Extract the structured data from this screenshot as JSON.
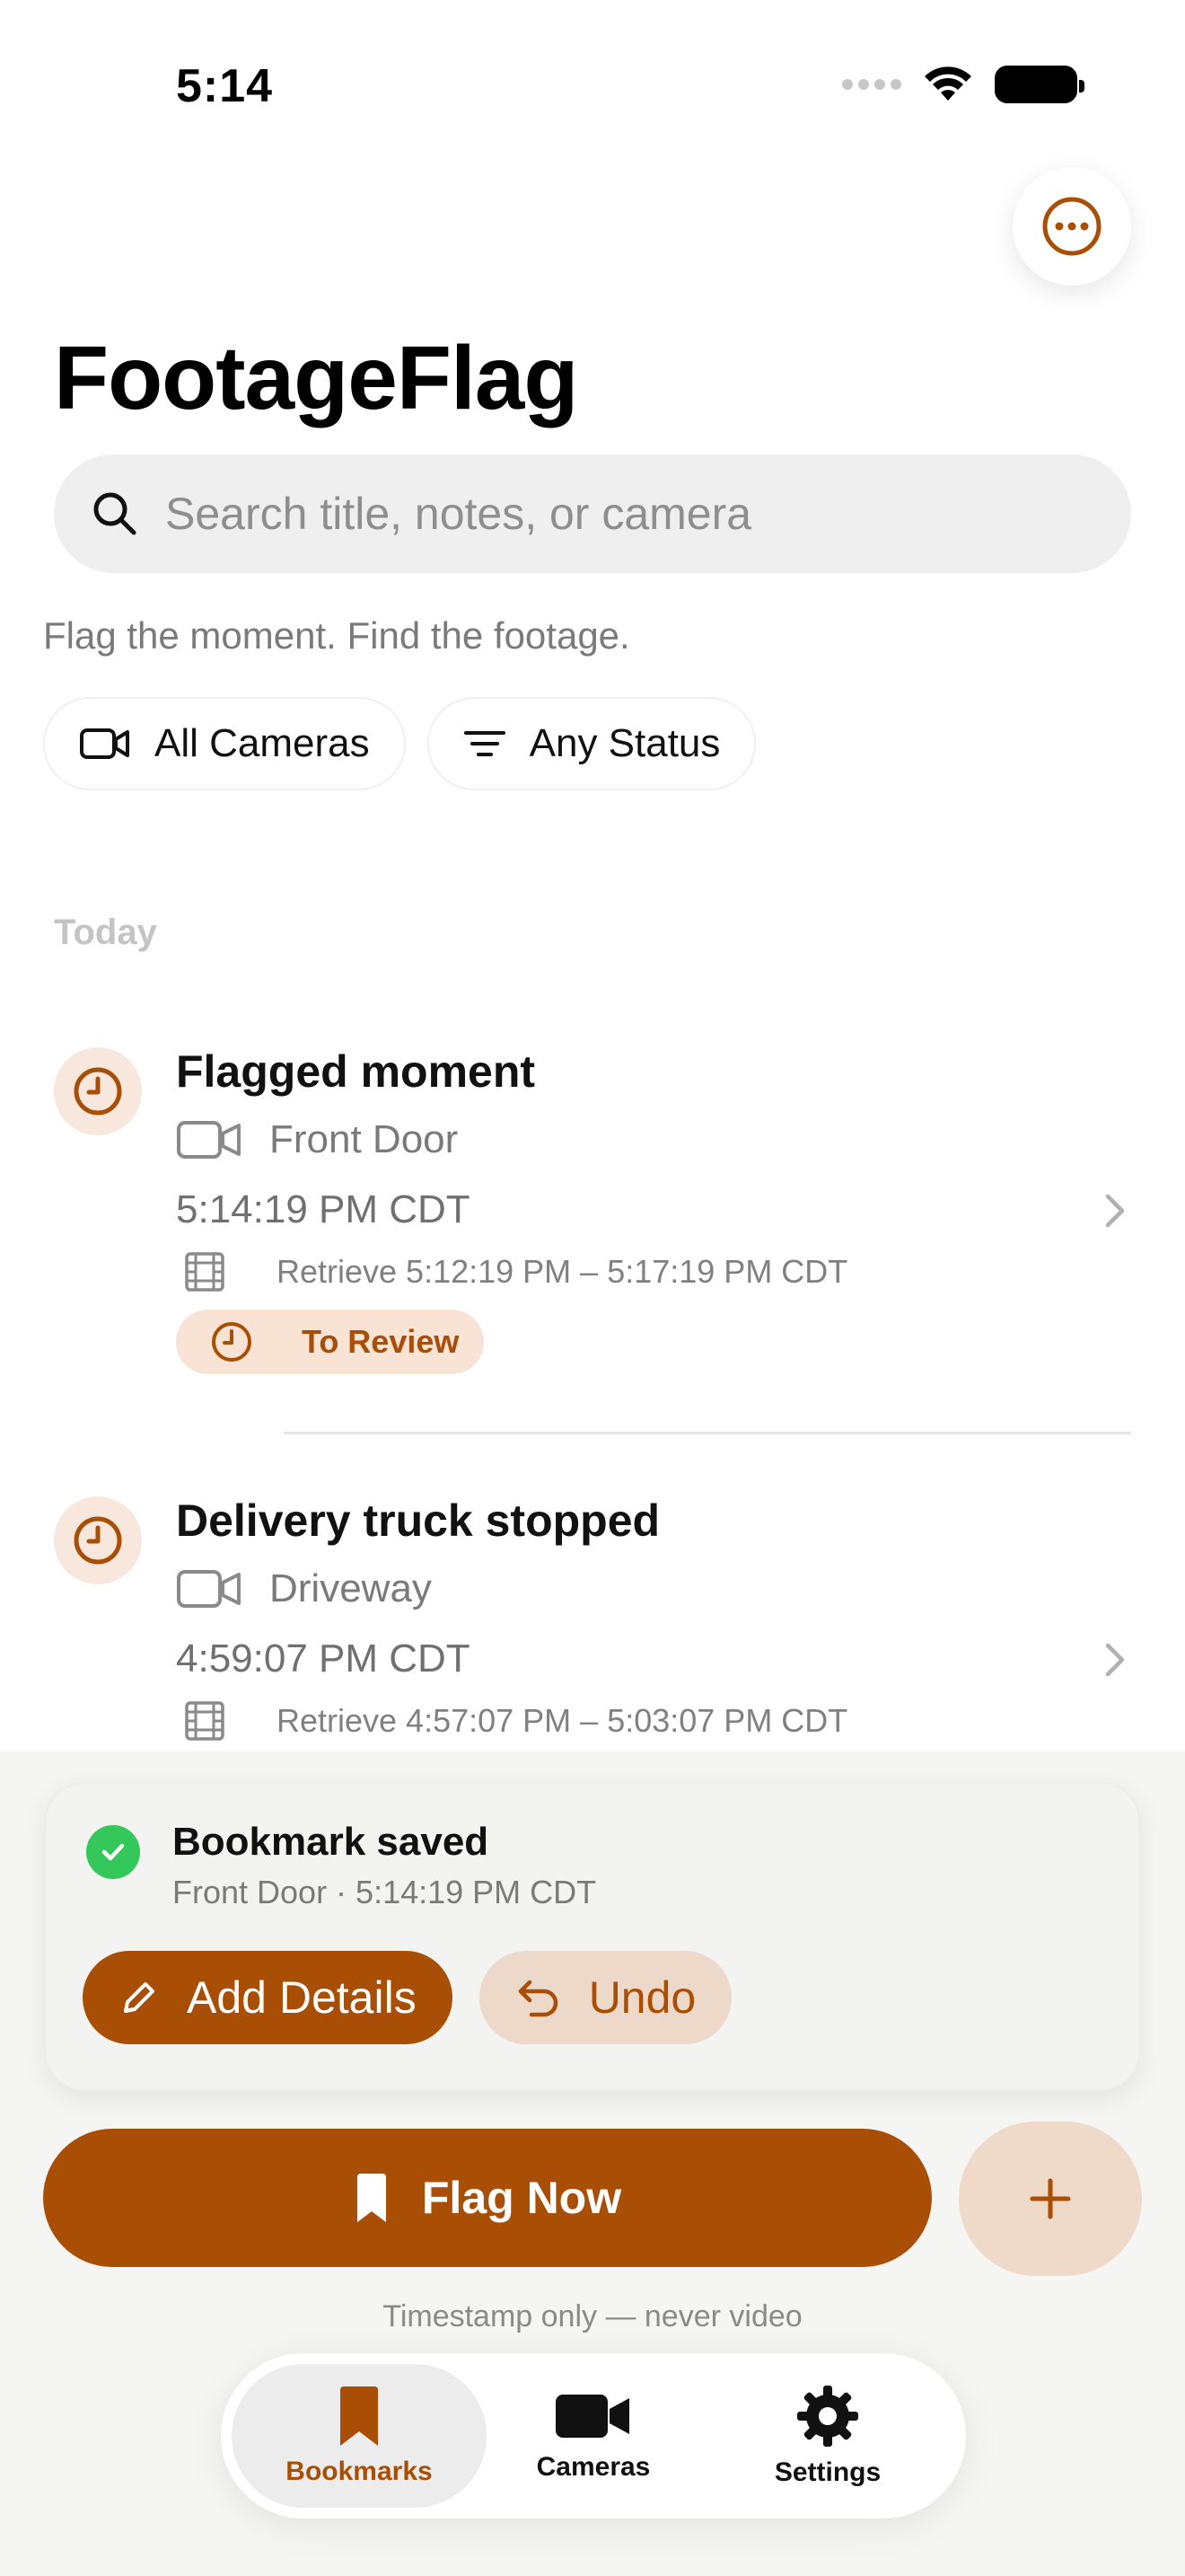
{
  "status_bar": {
    "time": "5:14"
  },
  "header": {
    "title": "FootageFlag"
  },
  "search": {
    "placeholder": "Search title, notes, or camera"
  },
  "tagline": "Flag the moment. Find the footage.",
  "filters": [
    {
      "label": "All Cameras",
      "icon": "video-camera-icon"
    },
    {
      "label": "Any Status",
      "icon": "filter-lines-icon"
    }
  ],
  "section": {
    "label": "Today"
  },
  "bookmarks": [
    {
      "title": "Flagged moment",
      "camera": "Front Door",
      "time": "5:14:19 PM CDT",
      "retrieve": "Retrieve 5:12:19 PM – 5:17:19 PM CDT",
      "status": "To Review"
    },
    {
      "title": "Delivery truck stopped",
      "camera": "Driveway",
      "time": "4:59:07 PM CDT",
      "retrieve": "Retrieve 4:57:07 PM – 5:03:07 PM CDT"
    }
  ],
  "toast": {
    "title": "Bookmark saved",
    "subtitle": "Front Door · 5:14:19 PM CDT",
    "add_details_label": "Add Details",
    "undo_label": "Undo"
  },
  "primary_action": {
    "label": "Flag Now"
  },
  "footnote": "Timestamp only — never video",
  "tabs": [
    {
      "label": "Bookmarks",
      "icon": "bookmark-icon",
      "active": true
    },
    {
      "label": "Cameras",
      "icon": "video-camera-icon",
      "active": false
    },
    {
      "label": "Settings",
      "icon": "gear-icon",
      "active": false
    }
  ],
  "colors": {
    "accent": "#a94e05",
    "accent_soft": "#efd9c8",
    "success": "#34c759"
  }
}
